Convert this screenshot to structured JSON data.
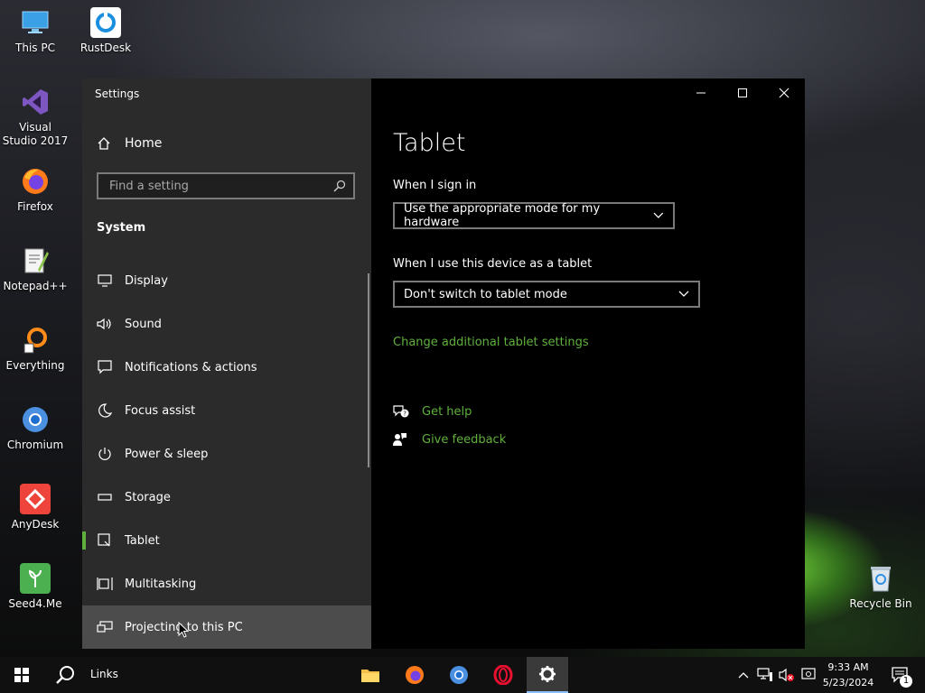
{
  "desktop": {
    "icons": [
      {
        "label": "This PC"
      },
      {
        "label": "RustDesk"
      },
      {
        "label": "Visual Studio 2017"
      },
      {
        "label": "Firefox"
      },
      {
        "label": "Notepad++"
      },
      {
        "label": "Everything"
      },
      {
        "label": "Chromium"
      },
      {
        "label": "AnyDesk"
      },
      {
        "label": "Seed4.Me"
      },
      {
        "label": "Recycle Bin"
      }
    ]
  },
  "window": {
    "title": "Settings",
    "home_label": "Home",
    "search_placeholder": "Find a setting",
    "section": "System",
    "nav": [
      {
        "label": "Display",
        "icon": "display-icon"
      },
      {
        "label": "Sound",
        "icon": "sound-icon"
      },
      {
        "label": "Notifications & actions",
        "icon": "notifications-icon"
      },
      {
        "label": "Focus assist",
        "icon": "moon-icon"
      },
      {
        "label": "Power & sleep",
        "icon": "power-icon"
      },
      {
        "label": "Storage",
        "icon": "storage-icon"
      },
      {
        "label": "Tablet",
        "icon": "tablet-icon",
        "active": true
      },
      {
        "label": "Multitasking",
        "icon": "multitasking-icon"
      },
      {
        "label": "Projecting to this PC",
        "icon": "projecting-icon",
        "hover": true
      }
    ]
  },
  "content": {
    "title": "Tablet",
    "sign_in_label": "When I sign in",
    "sign_in_value": "Use the appropriate mode for my hardware",
    "tablet_label": "When I use this device as a tablet",
    "tablet_value": "Don't switch to tablet mode",
    "additional_link": "Change additional tablet settings",
    "get_help": "Get help",
    "give_feedback": "Give feedback"
  },
  "taskbar": {
    "links": "Links",
    "time": "9:33 AM",
    "date": "5/23/2024",
    "notification_count": "1"
  },
  "colors": {
    "accent": "#5fb13c",
    "sidebar": "#2b2b2b",
    "content": "#000000"
  }
}
